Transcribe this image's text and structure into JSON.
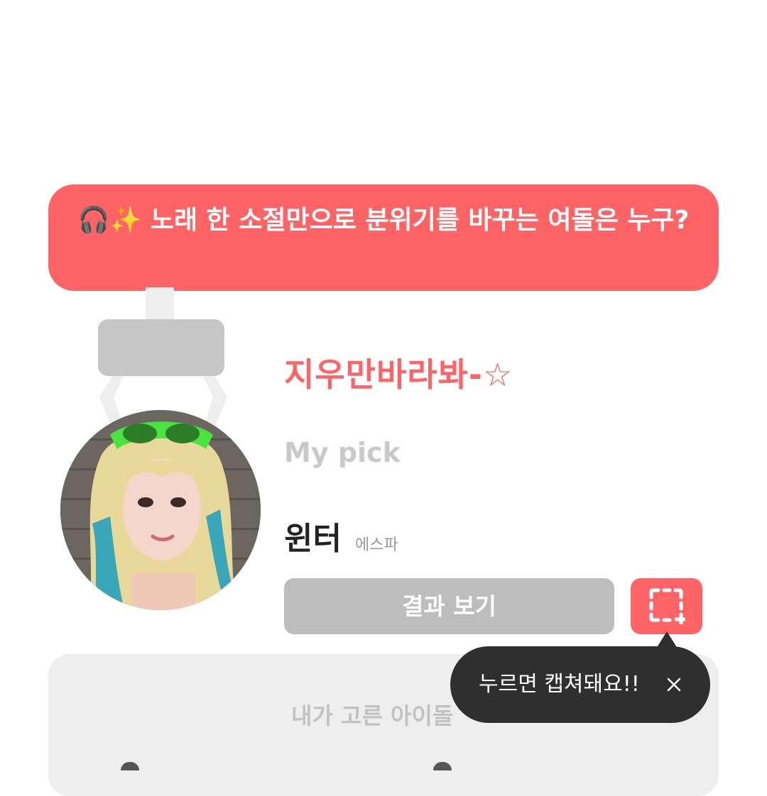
{
  "question": {
    "emoji": "🎧✨",
    "text": "노래 한 소절만으로 분위기를 바꾸는 여돌은 누구?"
  },
  "result": {
    "title": "지우만바라봐-☆",
    "pick_label": "My pick",
    "idol_name": "윈터",
    "group_name": "에스파",
    "view_result_label": "결과 보기"
  },
  "tooltip": {
    "text": "누르면 캡쳐돼요!!"
  },
  "bottom_card": {
    "title": "내가 고른 아이돌"
  },
  "icons": {
    "capture": "screenshot-capture-icon",
    "close": "close-icon"
  },
  "colors": {
    "accent": "#fe6466",
    "button_gray": "#bdbdbd",
    "tooltip_bg": "#2f2f2f",
    "card_bg": "#eeeeee"
  }
}
